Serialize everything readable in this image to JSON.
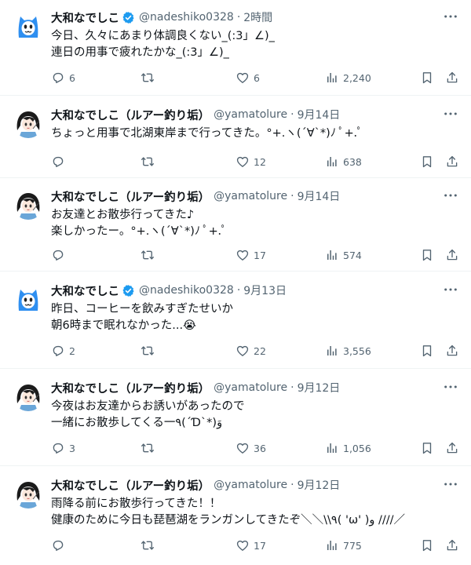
{
  "colors": {
    "text": "#0f1419",
    "secondary": "#536471",
    "verified": "#1d9bf0",
    "border": "#eff3f4"
  },
  "tweets": [
    {
      "author_name": "大和なでしこ",
      "verified": true,
      "handle": "@nadeshiko0328",
      "time": "2時間",
      "avatar": "nadeshiko-cat-avatar",
      "text": "今日、久々にあまり体調良くない_(:3」∠)_\n連日の用事で疲れたかな_(:3」∠)_",
      "replies": "6",
      "reposts": "",
      "likes": "6",
      "views": "2,240"
    },
    {
      "author_name": "大和なでしこ（ルアー釣り垢）",
      "verified": false,
      "handle": "@yamatolure",
      "time": "9月14日",
      "avatar": "lure-girl-avatar",
      "text": "ちょっと用事で北湖東岸まで行ってきた。°+.ヽ(´∀`*)ﾉ ﾟ+.ﾟ",
      "replies": "",
      "reposts": "",
      "likes": "12",
      "views": "638"
    },
    {
      "author_name": "大和なでしこ（ルアー釣り垢）",
      "verified": false,
      "handle": "@yamatolure",
      "time": "9月14日",
      "avatar": "lure-girl-avatar",
      "text": "お友達とお散歩行ってきた♪\n楽しかったー。°+.ヽ(´∀`*)ﾉ ﾟ+.ﾟ",
      "replies": "",
      "reposts": "",
      "likes": "17",
      "views": "574"
    },
    {
      "author_name": "大和なでしこ",
      "verified": true,
      "handle": "@nadeshiko0328",
      "time": "9月13日",
      "avatar": "nadeshiko-cat-avatar",
      "text": "昨日、コーヒーを飲みすぎたせいか\n朝6時まで眠れなかった...😭",
      "replies": "2",
      "reposts": "",
      "likes": "22",
      "views": "3,556"
    },
    {
      "author_name": "大和なでしこ（ルアー釣り垢）",
      "verified": false,
      "handle": "@yamatolure",
      "time": "9月12日",
      "avatar": "lure-girl-avatar",
      "text": "今夜はお友達からお誘いがあったので\n一緒にお散歩してくる一٩(´Ɗ`*)وَ",
      "replies": "3",
      "reposts": "",
      "likes": "36",
      "views": "1,056"
    },
    {
      "author_name": "大和なでしこ（ルアー釣り垢）",
      "verified": false,
      "handle": "@yamatolure",
      "time": "9月12日",
      "avatar": "lure-girl-avatar",
      "text": "雨降る前にお散歩行ってきた！！\n健康のために今日も琵琶湖をランガンしてきたぞ＼＼\\\\٩( 'ω' )و ////／",
      "replies": "",
      "reposts": "",
      "likes": "17",
      "views": "775"
    }
  ]
}
